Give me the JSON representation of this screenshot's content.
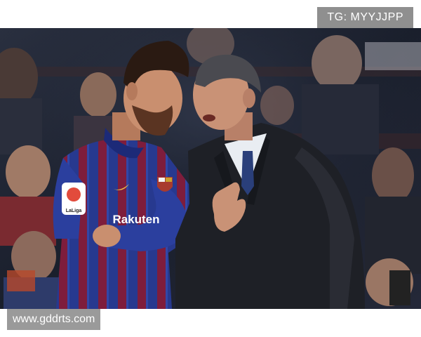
{
  "watermark": {
    "text": "TG: MYYJJPP"
  },
  "source": {
    "url_text": "www.gddrts.com"
  },
  "photo": {
    "kit_sponsor": "Rakuten",
    "sleeve_patch": "LaLiga",
    "colors": {
      "stands_dark": "#1c2233",
      "kit_blue": "#2b3f9e",
      "kit_red": "#8e1f3a",
      "coat": "#1e2026",
      "skin": "#c98f6f",
      "hair": "#2a1a12"
    }
  }
}
